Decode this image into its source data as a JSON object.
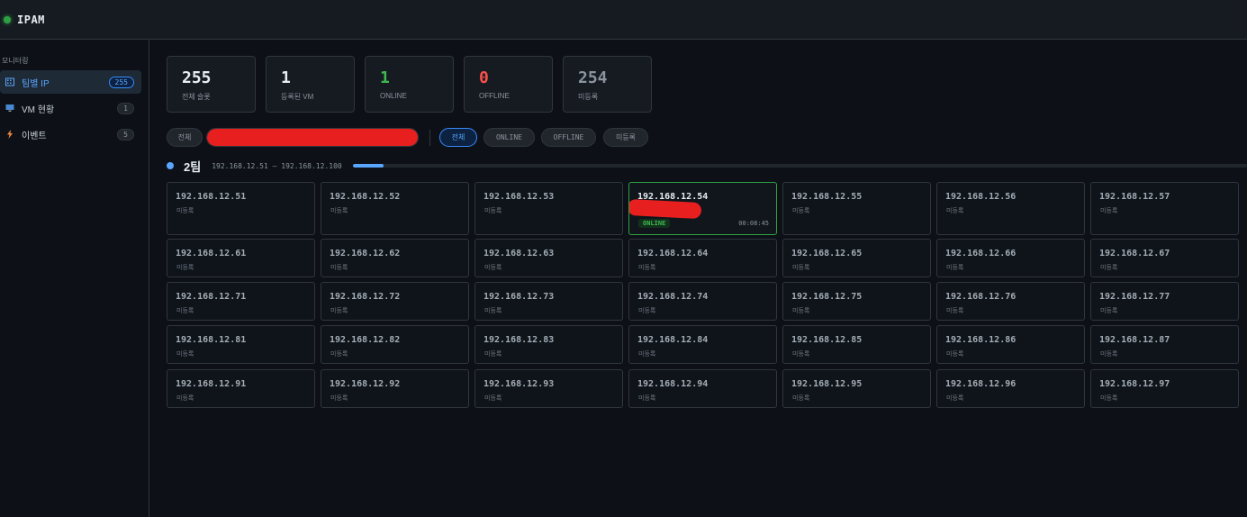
{
  "app": {
    "title": "IPAM"
  },
  "sidebar": {
    "section": "모니터링",
    "items": [
      {
        "label": "팀별 IP",
        "count": "255",
        "icon": "building-icon"
      },
      {
        "label": "VM 현황",
        "count": "1",
        "icon": "monitor-icon"
      },
      {
        "label": "이벤트",
        "count": "5",
        "icon": "lightning-icon"
      }
    ]
  },
  "stats": [
    {
      "value": "255",
      "label": "전체 슬롯",
      "color": "#e6edf3"
    },
    {
      "value": "1",
      "label": "등록된 VM",
      "color": "#e6edf3"
    },
    {
      "value": "1",
      "label": "ONLINE",
      "color": "#3fb950"
    },
    {
      "value": "0",
      "label": "OFFLINE",
      "color": "#f85149"
    },
    {
      "value": "254",
      "label": "미등록",
      "color": "#8b949e"
    }
  ],
  "filters": {
    "team_all": "전체",
    "status": [
      "전체",
      "ONLINE",
      "OFFLINE",
      "미등록"
    ],
    "active_status": "전체"
  },
  "group": {
    "name": "2팀",
    "range": "192.168.12.51 – 192.168.12.100",
    "progress": 0.035
  },
  "cards": [
    {
      "ip": "192.168.12.51",
      "status": "미등록"
    },
    {
      "ip": "192.168.12.52",
      "status": "미등록"
    },
    {
      "ip": "192.168.12.53",
      "status": "미등록"
    },
    {
      "ip": "192.168.12.54",
      "status": "ONLINE",
      "uptime": "00:08:45"
    },
    {
      "ip": "192.168.12.55",
      "status": "미등록"
    },
    {
      "ip": "192.168.12.56",
      "status": "미등록"
    },
    {
      "ip": "192.168.12.57",
      "status": "미등록"
    },
    {
      "ip": "192.168.12.61",
      "status": "미등록"
    },
    {
      "ip": "192.168.12.62",
      "status": "미등록"
    },
    {
      "ip": "192.168.12.63",
      "status": "미등록"
    },
    {
      "ip": "192.168.12.64",
      "status": "미등록"
    },
    {
      "ip": "192.168.12.65",
      "status": "미등록"
    },
    {
      "ip": "192.168.12.66",
      "status": "미등록"
    },
    {
      "ip": "192.168.12.67",
      "status": "미등록"
    },
    {
      "ip": "192.168.12.71",
      "status": "미등록"
    },
    {
      "ip": "192.168.12.72",
      "status": "미등록"
    },
    {
      "ip": "192.168.12.73",
      "status": "미등록"
    },
    {
      "ip": "192.168.12.74",
      "status": "미등록"
    },
    {
      "ip": "192.168.12.75",
      "status": "미등록"
    },
    {
      "ip": "192.168.12.76",
      "status": "미등록"
    },
    {
      "ip": "192.168.12.77",
      "status": "미등록"
    },
    {
      "ip": "192.168.12.81",
      "status": "미등록"
    },
    {
      "ip": "192.168.12.82",
      "status": "미등록"
    },
    {
      "ip": "192.168.12.83",
      "status": "미등록"
    },
    {
      "ip": "192.168.12.84",
      "status": "미등록"
    },
    {
      "ip": "192.168.12.85",
      "status": "미등록"
    },
    {
      "ip": "192.168.12.86",
      "status": "미등록"
    },
    {
      "ip": "192.168.12.87",
      "status": "미등록"
    },
    {
      "ip": "192.168.12.91",
      "status": "미등록"
    },
    {
      "ip": "192.168.12.92",
      "status": "미등록"
    },
    {
      "ip": "192.168.12.93",
      "status": "미등록"
    },
    {
      "ip": "192.168.12.94",
      "status": "미등록"
    },
    {
      "ip": "192.168.12.95",
      "status": "미등록"
    },
    {
      "ip": "192.168.12.96",
      "status": "미등록"
    },
    {
      "ip": "192.168.12.97",
      "status": "미등록"
    }
  ]
}
